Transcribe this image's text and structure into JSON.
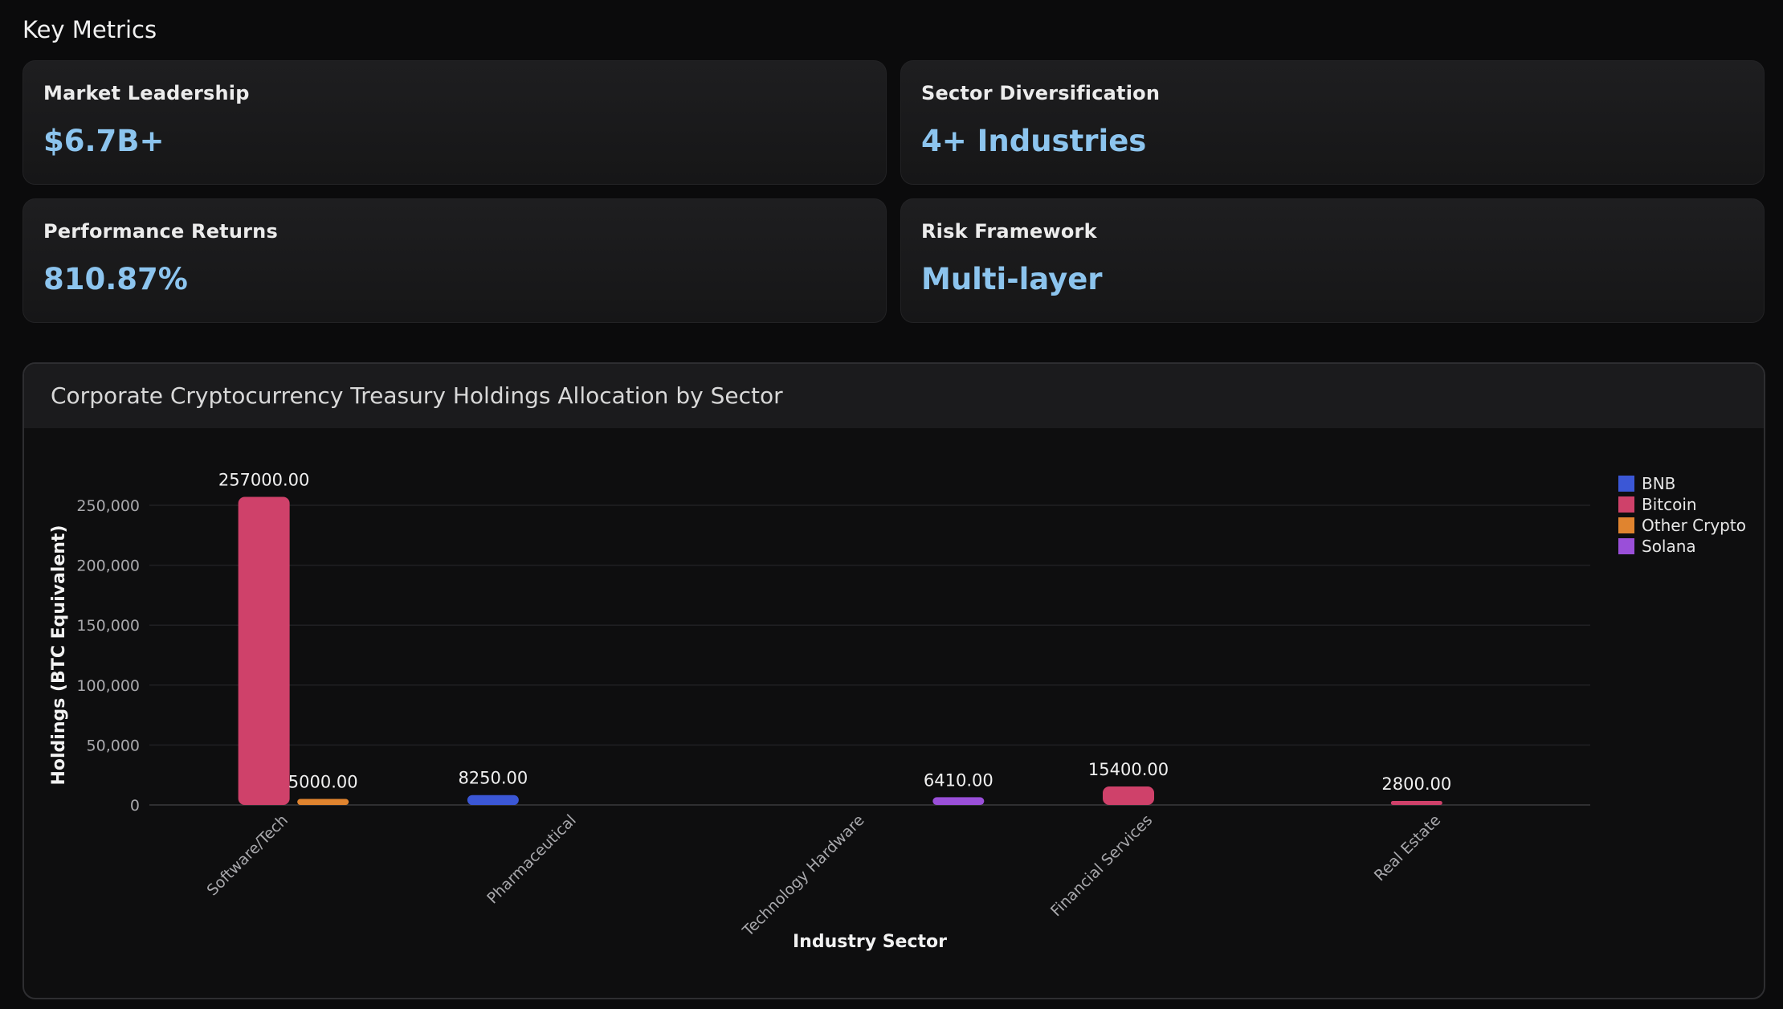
{
  "section_title": "Key Metrics",
  "metrics": [
    {
      "label": "Market Leadership",
      "value": "$6.7B+"
    },
    {
      "label": "Sector Diversification",
      "value": "4+ Industries"
    },
    {
      "label": "Performance Returns",
      "value": "810.87%"
    },
    {
      "label": "Risk Framework",
      "value": "Multi-layer"
    }
  ],
  "chart_panel": {
    "title": "Corporate Cryptocurrency Treasury Holdings Allocation by Sector"
  },
  "colors": {
    "accent": "#8cc4ee",
    "background": "#0b0b0c"
  },
  "chart_data": {
    "type": "bar",
    "title": "Corporate Cryptocurrency Treasury Holdings Allocation by Sector",
    "xlabel": "Industry Sector",
    "ylabel": "Holdings (BTC Equivalent)",
    "ylim": [
      0,
      250000
    ],
    "yticks": [
      0,
      50000,
      100000,
      150000,
      200000,
      250000
    ],
    "ytick_labels": [
      "0",
      "50,000",
      "100,000",
      "150,000",
      "200,000",
      "250,000"
    ],
    "categories": [
      "Software/Tech",
      "Pharmaceutical",
      "Technology Hardware",
      "Financial Services",
      "Real Estate"
    ],
    "legend_position": "top-right",
    "grid": true,
    "series": [
      {
        "name": "BNB",
        "color": "#3b57d6",
        "values": [
          null,
          8250,
          null,
          null,
          null
        ]
      },
      {
        "name": "Bitcoin",
        "color": "#cf416a",
        "values": [
          257000,
          null,
          null,
          15400,
          2800
        ]
      },
      {
        "name": "Other Crypto",
        "color": "#e0842f",
        "values": [
          5000,
          null,
          null,
          null,
          null
        ]
      },
      {
        "name": "Solana",
        "color": "#9a4fd9",
        "values": [
          null,
          null,
          6410,
          null,
          null
        ]
      }
    ],
    "data_labels": [
      {
        "series": "Bitcoin",
        "category": "Software/Tech",
        "text": "257000.00"
      },
      {
        "series": "Other Crypto",
        "category": "Software/Tech",
        "text": "5000.00"
      },
      {
        "series": "BNB",
        "category": "Pharmaceutical",
        "text": "8250.00"
      },
      {
        "series": "Solana",
        "category": "Technology Hardware",
        "text": "6410.00"
      },
      {
        "series": "Bitcoin",
        "category": "Financial Services",
        "text": "15400.00"
      },
      {
        "series": "Bitcoin",
        "category": "Real Estate",
        "text": "2800.00"
      }
    ]
  }
}
